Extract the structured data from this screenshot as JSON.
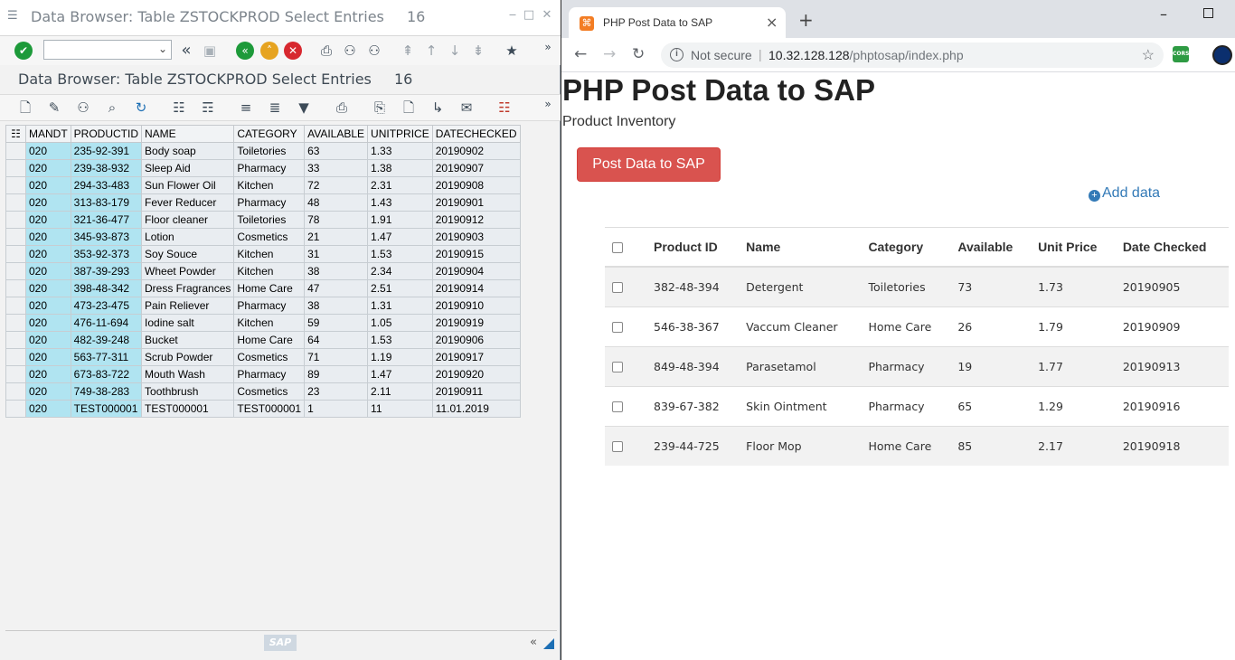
{
  "sap": {
    "window_title": "Data Browser: Table ZSTOCKPROD Select Entries",
    "window_count": "16",
    "subtitle": "Data Browser: Table ZSTOCKPROD Select Entries",
    "subtitle_count": "16",
    "command_field": "",
    "columns": [
      "MANDT",
      "PRODUCTID",
      "NAME",
      "CATEGORY",
      "AVAILABLE",
      "UNITPRICE",
      "DATECHECKED"
    ],
    "rows": [
      [
        "020",
        "235-92-391",
        "Body soap",
        "Toiletories",
        "63",
        "1.33",
        "20190902"
      ],
      [
        "020",
        "239-38-932",
        "Sleep Aid",
        "Pharmacy",
        "33",
        "1.38",
        "20190907"
      ],
      [
        "020",
        "294-33-483",
        "Sun Flower Oil",
        "Kitchen",
        "72",
        "2.31",
        "20190908"
      ],
      [
        "020",
        "313-83-179",
        "Fever Reducer",
        "Pharmacy",
        "48",
        "1.43",
        "20190901"
      ],
      [
        "020",
        "321-36-477",
        "Floor cleaner",
        "Toiletories",
        "78",
        "1.91",
        "20190912"
      ],
      [
        "020",
        "345-93-873",
        "Lotion",
        "Cosmetics",
        "21",
        "1.47",
        "20190903"
      ],
      [
        "020",
        "353-92-373",
        "Soy Souce",
        "Kitchen",
        "31",
        "1.53",
        "20190915"
      ],
      [
        "020",
        "387-39-293",
        "Wheet Powder",
        "Kitchen",
        "38",
        "2.34",
        "20190904"
      ],
      [
        "020",
        "398-48-342",
        "Dress Fragrances",
        "Home Care",
        "47",
        "2.51",
        "20190914"
      ],
      [
        "020",
        "473-23-475",
        "Pain Reliever",
        "Pharmacy",
        "38",
        "1.31",
        "20190910"
      ],
      [
        "020",
        "476-11-694",
        "Iodine salt",
        "Kitchen",
        "59",
        "1.05",
        "20190919"
      ],
      [
        "020",
        "482-39-248",
        "Bucket",
        "Home Care",
        "64",
        "1.53",
        "20190906"
      ],
      [
        "020",
        "563-77-311",
        "Scrub Powder",
        "Cosmetics",
        "71",
        "1.19",
        "20190917"
      ],
      [
        "020",
        "673-83-722",
        "Mouth Wash",
        "Pharmacy",
        "89",
        "1.47",
        "20190920"
      ],
      [
        "020",
        "749-38-283",
        "Toothbrush",
        "Cosmetics",
        "23",
        "2.11",
        "20190911"
      ],
      [
        "020",
        "TEST000001",
        "TEST000001",
        "TEST000001",
        "1",
        "11",
        "11.01.2019"
      ]
    ],
    "logo_text": "SAP"
  },
  "browser": {
    "tab_title": "PHP Post Data to SAP",
    "not_secure": "Not secure",
    "url_host": "10.32.128.128",
    "url_path": "/phptosap/index.php",
    "ext_label": "CORS"
  },
  "page": {
    "heading": "PHP Post Data to SAP",
    "subtitle": "Product Inventory",
    "post_button": "Post Data to SAP",
    "add_link": "Add data",
    "columns": [
      "Product ID",
      "Name",
      "Category",
      "Available",
      "Unit Price",
      "Date Checked"
    ],
    "rows": [
      [
        "382-48-394",
        "Detergent",
        "Toiletories",
        "73",
        "1.73",
        "20190905"
      ],
      [
        "546-38-367",
        "Vaccum Cleaner",
        "Home Care",
        "26",
        "1.79",
        "20190909"
      ],
      [
        "849-48-394",
        "Parasetamol",
        "Pharmacy",
        "19",
        "1.77",
        "20190913"
      ],
      [
        "839-67-382",
        "Skin Ointment",
        "Pharmacy",
        "65",
        "1.29",
        "20190916"
      ],
      [
        "239-44-725",
        "Floor Mop",
        "Home Care",
        "85",
        "2.17",
        "20190918"
      ]
    ]
  }
}
